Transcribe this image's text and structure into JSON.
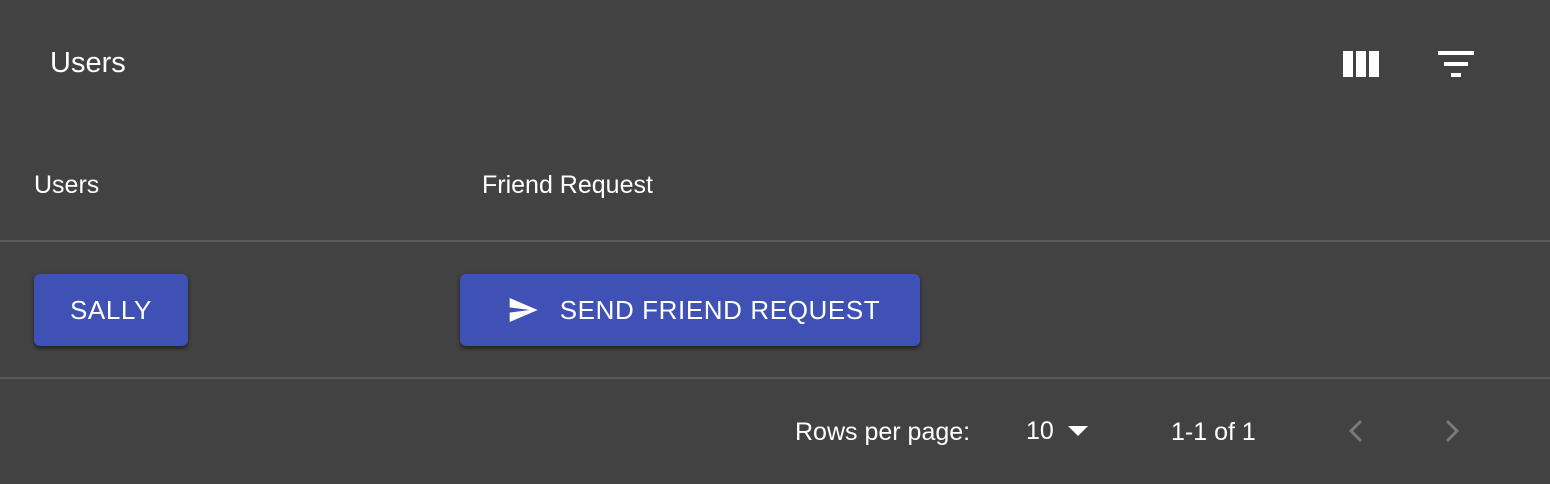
{
  "toolbar": {
    "title": "Users",
    "columns_icon": "view-column-icon",
    "filter_icon": "filter-list-icon"
  },
  "table": {
    "columns": [
      "Users",
      "Friend Request"
    ],
    "rows": [
      {
        "user_button_label": "SALLY",
        "friend_button_label": "SEND FRIEND REQUEST",
        "friend_button_icon": "send-icon"
      }
    ]
  },
  "pagination": {
    "rows_per_page_label": "Rows per page:",
    "rows_per_page_value": "10",
    "range_text": "1-1 of 1",
    "prev_icon": "chevron-left-icon",
    "next_icon": "chevron-right-icon"
  },
  "colors": {
    "background": "#424242",
    "button": "#3f51b5",
    "divider": "#5a5a5a"
  }
}
